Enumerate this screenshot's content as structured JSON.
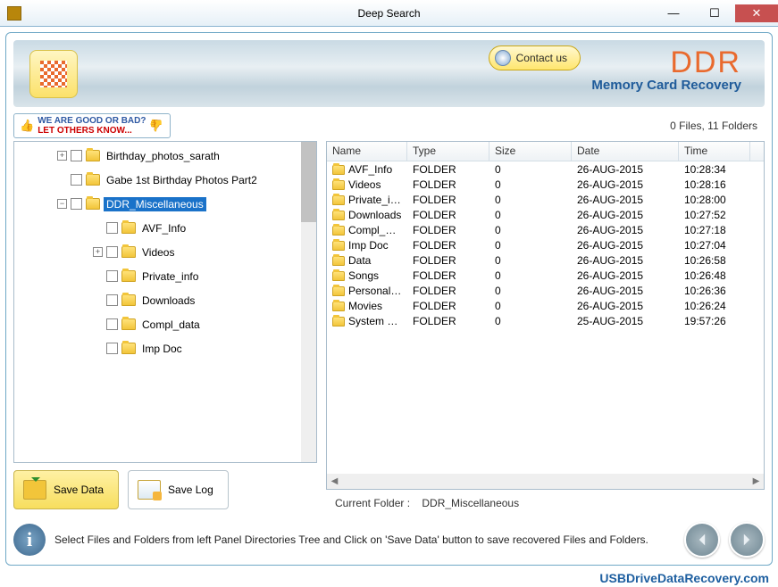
{
  "window": {
    "title": "Deep Search"
  },
  "banner": {
    "contact_label": "Contact us",
    "brand": "DDR",
    "brand_sub": "Memory Card Recovery"
  },
  "review": {
    "line1": "WE ARE GOOD OR BAD?",
    "line2": "LET OTHERS KNOW..."
  },
  "stats": {
    "text": "0 Files, 11 Folders"
  },
  "tree": [
    {
      "depth": 0,
      "exp": "+",
      "label": "Birthday_photos_sarath",
      "sel": false
    },
    {
      "depth": 0,
      "exp": "",
      "label": "Gabe 1st Birthday Photos Part2",
      "sel": false
    },
    {
      "depth": 1,
      "exp": "−",
      "label": "DDR_Miscellaneous",
      "sel": true
    },
    {
      "depth": 2,
      "exp": "",
      "label": "AVF_Info",
      "sel": false
    },
    {
      "depth": 2,
      "exp": "+",
      "label": "Videos",
      "sel": false
    },
    {
      "depth": 2,
      "exp": "",
      "label": "Private_info",
      "sel": false
    },
    {
      "depth": 2,
      "exp": "",
      "label": "Downloads",
      "sel": false
    },
    {
      "depth": 2,
      "exp": "",
      "label": "Compl_data",
      "sel": false
    },
    {
      "depth": 2,
      "exp": "",
      "label": "Imp Doc",
      "sel": false
    }
  ],
  "columns": [
    "Name",
    "Type",
    "Size",
    "Date",
    "Time"
  ],
  "rows": [
    {
      "name": "AVF_Info",
      "type": "FOLDER",
      "size": "0",
      "date": "26-AUG-2015",
      "time": "10:28:34"
    },
    {
      "name": "Videos",
      "type": "FOLDER",
      "size": "0",
      "date": "26-AUG-2015",
      "time": "10:28:16"
    },
    {
      "name": "Private_info",
      "type": "FOLDER",
      "size": "0",
      "date": "26-AUG-2015",
      "time": "10:28:00"
    },
    {
      "name": "Downloads",
      "type": "FOLDER",
      "size": "0",
      "date": "26-AUG-2015",
      "time": "10:27:52"
    },
    {
      "name": "Compl_data",
      "type": "FOLDER",
      "size": "0",
      "date": "26-AUG-2015",
      "time": "10:27:18"
    },
    {
      "name": "Imp Doc",
      "type": "FOLDER",
      "size": "0",
      "date": "26-AUG-2015",
      "time": "10:27:04"
    },
    {
      "name": "Data",
      "type": "FOLDER",
      "size": "0",
      "date": "26-AUG-2015",
      "time": "10:26:58"
    },
    {
      "name": "Songs",
      "type": "FOLDER",
      "size": "0",
      "date": "26-AUG-2015",
      "time": "10:26:48"
    },
    {
      "name": "Personal Pho...",
      "type": "FOLDER",
      "size": "0",
      "date": "26-AUG-2015",
      "time": "10:26:36"
    },
    {
      "name": "Movies",
      "type": "FOLDER",
      "size": "0",
      "date": "26-AUG-2015",
      "time": "10:26:24"
    },
    {
      "name": "System Volu...",
      "type": "FOLDER",
      "size": "0",
      "date": "25-AUG-2015",
      "time": "19:57:26"
    }
  ],
  "buttons": {
    "save_data": "Save Data",
    "save_log": "Save Log"
  },
  "current": {
    "label": "Current Folder :",
    "value": "DDR_Miscellaneous"
  },
  "tip": "Select Files and Folders from left Panel Directories Tree and Click on 'Save Data' button to save recovered Files and Folders.",
  "site": "USBDriveDataRecovery.com"
}
